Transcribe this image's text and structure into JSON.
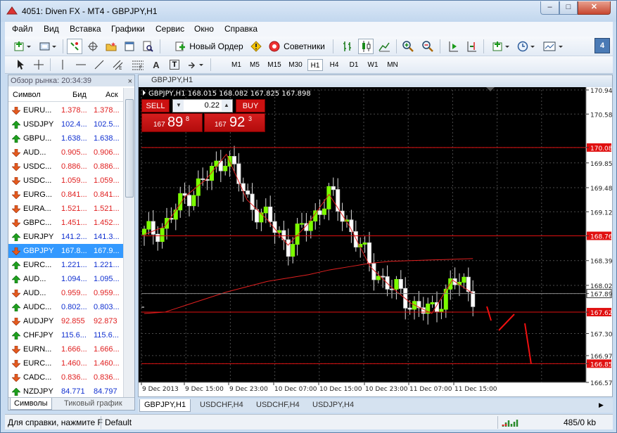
{
  "window": {
    "title": "4051: Diven FX - MT4 - GBPJPY,H1",
    "min": "–",
    "max": "□",
    "close": "✕"
  },
  "menu": [
    "Файл",
    "Вид",
    "Вставка",
    "Графики",
    "Сервис",
    "Окно",
    "Справка"
  ],
  "toolbar": {
    "new_order": "Новый Ордер",
    "experts": "Советники",
    "draw_text": "A",
    "draw_label": "T",
    "timeframes": [
      "M1",
      "M5",
      "M15",
      "M30",
      "H1",
      "H4",
      "D1",
      "W1",
      "MN"
    ],
    "active_timeframe": "H1",
    "badge": "4"
  },
  "market_watch": {
    "title": "Обзор рынка: 20:34:39",
    "close": "×",
    "columns": {
      "symbol": "Символ",
      "bid": "Бид",
      "ask": "Аск"
    },
    "rows": [
      {
        "symbol": "EURU...",
        "bid": "1.378...",
        "ask": "1.378...",
        "dir": "down"
      },
      {
        "symbol": "USDJPY",
        "bid": "102.4...",
        "ask": "102.5...",
        "dir": "up"
      },
      {
        "symbol": "GBPU...",
        "bid": "1.638...",
        "ask": "1.638...",
        "dir": "up"
      },
      {
        "symbol": "AUD...",
        "bid": "0.905...",
        "ask": "0.906...",
        "dir": "down"
      },
      {
        "symbol": "USDC...",
        "bid": "0.886...",
        "ask": "0.886...",
        "dir": "down"
      },
      {
        "symbol": "USDC...",
        "bid": "1.059...",
        "ask": "1.059...",
        "dir": "down"
      },
      {
        "symbol": "EURG...",
        "bid": "0.841...",
        "ask": "0.841...",
        "dir": "down"
      },
      {
        "symbol": "EURA...",
        "bid": "1.521...",
        "ask": "1.521...",
        "dir": "down"
      },
      {
        "symbol": "GBPC...",
        "bid": "1.451...",
        "ask": "1.452...",
        "dir": "down"
      },
      {
        "symbol": "EURJPY",
        "bid": "141.2...",
        "ask": "141.3...",
        "dir": "up"
      },
      {
        "symbol": "GBPJPY",
        "bid": "167.8...",
        "ask": "167.9...",
        "dir": "down",
        "selected": true
      },
      {
        "symbol": "EURC...",
        "bid": "1.221...",
        "ask": "1.221...",
        "dir": "up"
      },
      {
        "symbol": "AUD...",
        "bid": "1.094...",
        "ask": "1.095...",
        "dir": "up"
      },
      {
        "symbol": "AUD...",
        "bid": "0.959...",
        "ask": "0.959...",
        "dir": "down"
      },
      {
        "symbol": "AUDC...",
        "bid": "0.802...",
        "ask": "0.803...",
        "dir": "up"
      },
      {
        "symbol": "AUDJPY",
        "bid": "92.855",
        "ask": "92.873",
        "dir": "down"
      },
      {
        "symbol": "CHFJPY",
        "bid": "115.6...",
        "ask": "115.6...",
        "dir": "up"
      },
      {
        "symbol": "EURN...",
        "bid": "1.666...",
        "ask": "1.666...",
        "dir": "down"
      },
      {
        "symbol": "EURC...",
        "bid": "1.460...",
        "ask": "1.460...",
        "dir": "down"
      },
      {
        "symbol": "CADC...",
        "bid": "0.836...",
        "ask": "0.836...",
        "dir": "down"
      },
      {
        "symbol": "NZDJPY",
        "bid": "84.771",
        "ask": "84.797",
        "dir": "up"
      }
    ],
    "tabs": [
      "Символы",
      "Тиковый график"
    ],
    "active_tab": "Символы"
  },
  "chart": {
    "caption": "GBPJPY,H1",
    "info": "GBPJPY,H1  168.015 168.082 167.825 167.898",
    "one_click": {
      "sell": "SELL",
      "buy": "BUY",
      "lot": "0.22",
      "sell_price": {
        "prefix": "167",
        "big": "89",
        "sup": "8"
      },
      "buy_price": {
        "prefix": "167",
        "big": "92",
        "sup": "3"
      }
    },
    "price_labels": [
      "170.940",
      "170.580",
      "170.080",
      "169.850",
      "169.480",
      "169.120",
      "168.760",
      "168.390",
      "168.020",
      "167.898",
      "167.620",
      "167.300",
      "166.970",
      "166.850",
      "166.570"
    ],
    "time_labels": [
      "9 Dec 2013",
      "9 Dec 15:00",
      "9 Dec 23:00",
      "10 Dec 07:00",
      "10 Dec 15:00",
      "10 Dec 23:00",
      "11 Dec 07:00",
      "11 Dec 15:00"
    ],
    "hlines": [
      170.08,
      168.76,
      167.62,
      166.85
    ],
    "current_price": 167.898,
    "tabs": [
      "GBPJPY,H1",
      "USDCHF,H4",
      "USDCHF,H4",
      "USDJPY,H4"
    ],
    "active_tab": "GBPJPY,H1",
    "chart_data": {
      "type": "line",
      "title": "",
      "x": [
        0,
        5,
        10,
        15,
        20,
        25,
        30,
        35,
        40,
        45,
        50,
        55,
        60,
        65,
        70,
        75,
        80
      ],
      "series": [
        {
          "values": [
            168.78,
            168.9,
            169.35,
            169.6,
            169.98,
            169.3,
            169.0,
            168.62,
            168.95,
            169.38,
            168.9,
            168.3,
            168.0,
            167.75,
            167.6,
            168.1,
            167.9
          ]
        },
        {
          "values": [
            167.6,
            167.62,
            167.72,
            167.82,
            167.92,
            168.0,
            168.08,
            168.13,
            168.18,
            168.25,
            168.3,
            168.35,
            168.38,
            168.39,
            168.4,
            168.41,
            168.42
          ]
        }
      ],
      "ylim": [
        166.57,
        170.94
      ]
    }
  },
  "status": {
    "help": "Для справки, нажмите F",
    "profile": "Default",
    "traffic": "485/0 kb"
  }
}
